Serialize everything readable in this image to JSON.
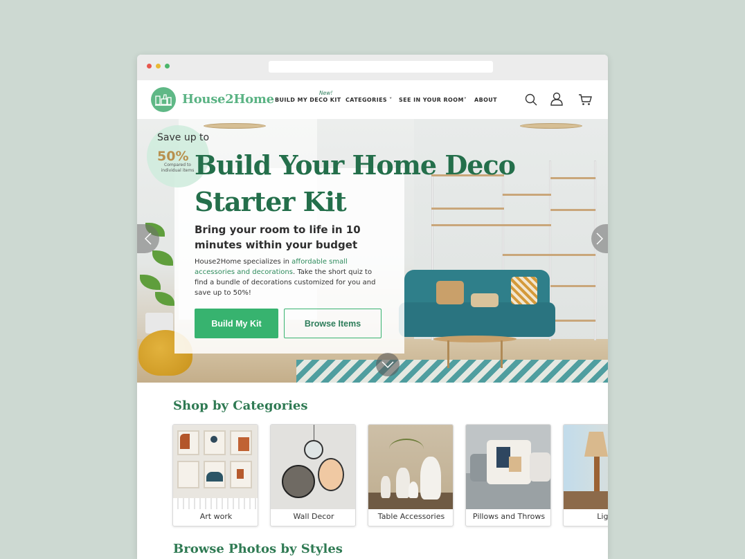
{
  "brand": {
    "name": "House2Home",
    "accent": "#37b36f",
    "title_color": "#246f4b"
  },
  "nav": {
    "new_badge": "New!",
    "items": [
      {
        "label": "BUILD MY DECO KIT"
      },
      {
        "label": "CATEGORIES ˅"
      },
      {
        "label": "SEE IN YOUR ROOM˅"
      },
      {
        "label": "ABOUT"
      }
    ],
    "icons": [
      "search-icon",
      "user-icon",
      "cart-icon"
    ]
  },
  "hero": {
    "save_up": "Save up to",
    "save_pct": "50%",
    "save_note": "Compared to individual items",
    "title": "Build Your Home Deco Starter Kit",
    "subtitle": "Bring your room to life in 10 minutes within your budget",
    "body_pre": "House2Home specializes in ",
    "body_highlight": "affordable small accessories and decorations",
    "body_post": ". Take the short quiz to find a bundle of decorations customized for you and save up to 50%!",
    "primary_button": "Build My Kit",
    "secondary_button": "Browse Items"
  },
  "categories": {
    "title": "Shop by Categories",
    "items": [
      {
        "label": "Art work"
      },
      {
        "label": "Wall Decor"
      },
      {
        "label": "Table Accessories"
      },
      {
        "label": "Pillows and Throws"
      },
      {
        "label": "Light"
      }
    ]
  },
  "styles_section": {
    "title": "Browse Photos by Styles"
  }
}
